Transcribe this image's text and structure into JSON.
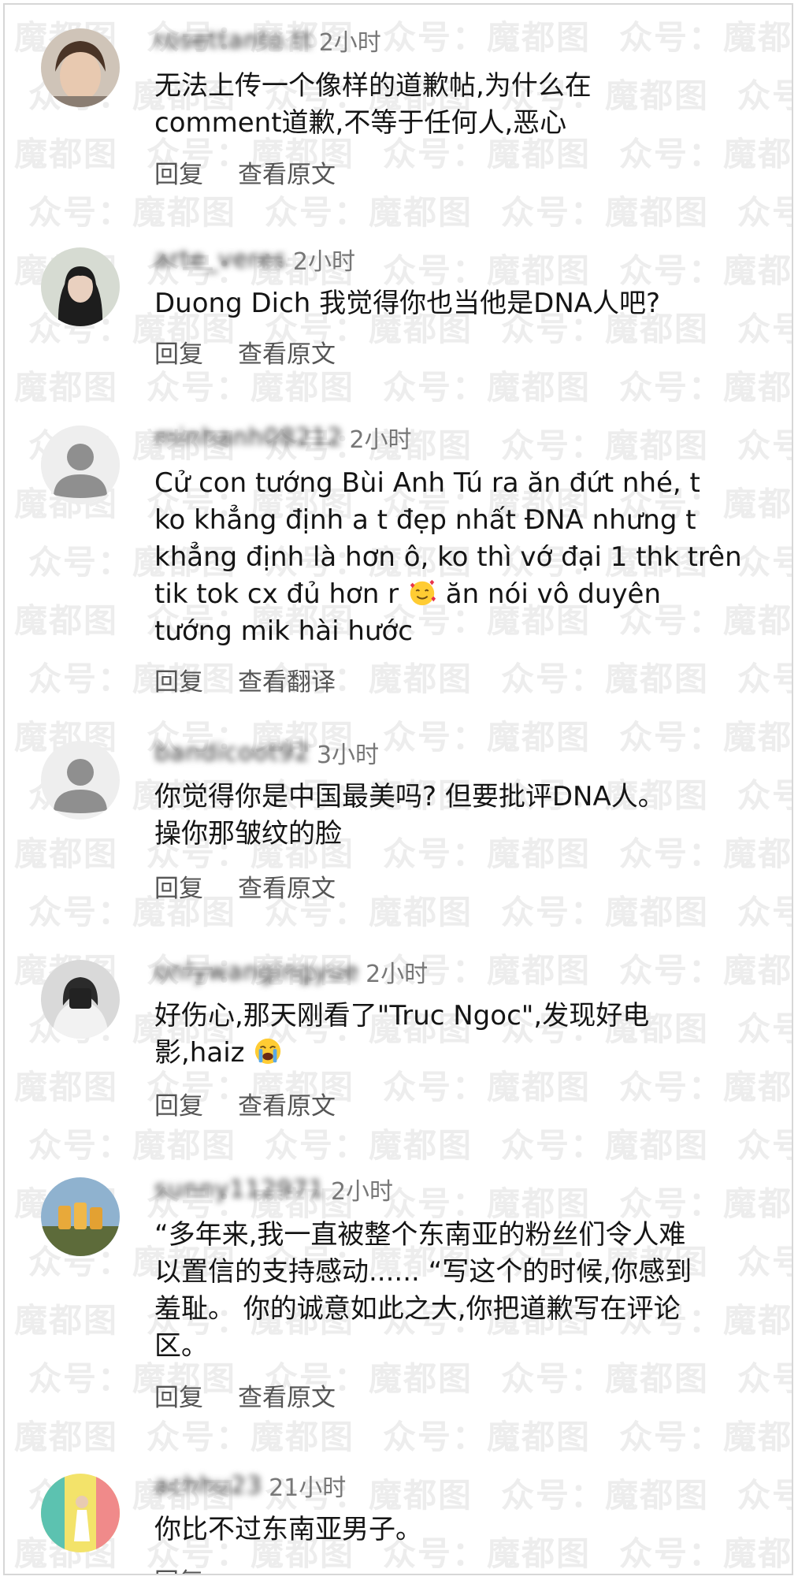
{
  "watermark_text": "众号：魔都图",
  "actions": {
    "reply": "回复",
    "view_original": "查看原文",
    "view_translation": "查看翻译"
  },
  "comments": [
    {
      "username": "rosettanto.tt",
      "time": "2小时",
      "lines": [
        "无法上传一个像样的道歉帖,为什么在",
        "comment道歉,不等于任何人,恶心"
      ],
      "second_action": "查看原文"
    },
    {
      "username": "arte_veres",
      "time": "2小时",
      "lines": [
        "Duong Dich 我觉得你也当他是DNA人吧?"
      ],
      "second_action": "查看原文"
    },
    {
      "username": "minhanh08212",
      "time": "2小时",
      "lines": [
        "Cử con tướng Bùi Anh Tú ra ăn đứt  nhé, t",
        "ko khẳng định a t đẹp nhất ĐNA nhưng t",
        "khẳng định là hơn ô, ko thì vớ đại 1 thk trên",
        "tik tok cx đủ hơn r",
        "tướng mik hài hước"
      ],
      "line4_tail": "ăn nói vô duyên",
      "second_action": "查看翻译"
    },
    {
      "username": "bandicoot92",
      "time": "3小时",
      "lines": [
        "你觉得你是中国最美吗? 但要批评DNA人。",
        "操你那皱纹的脸"
      ],
      "second_action": "查看原文"
    },
    {
      "username": "onlywangingyue",
      "time": "2小时",
      "lines": [
        "好伤心,那天刚看了\"Truc Ngoc\",发现好电",
        "影,haiz"
      ],
      "second_action": "查看原文"
    },
    {
      "username": "sunny112971",
      "time": "2小时",
      "lines": [
        "“多年来,我一直被整个东南亚的粉丝们令人难",
        "以置信的支持感动...... “写这个的时候,你感到",
        "羞耻。 你的诚意如此之大,你把道歉写在评论",
        "区。"
      ],
      "second_action": "查看原文"
    },
    {
      "username": "achhu23",
      "time": "21小时",
      "lines": [
        "你比不过东南亚男子。"
      ],
      "second_action": "回复"
    }
  ]
}
